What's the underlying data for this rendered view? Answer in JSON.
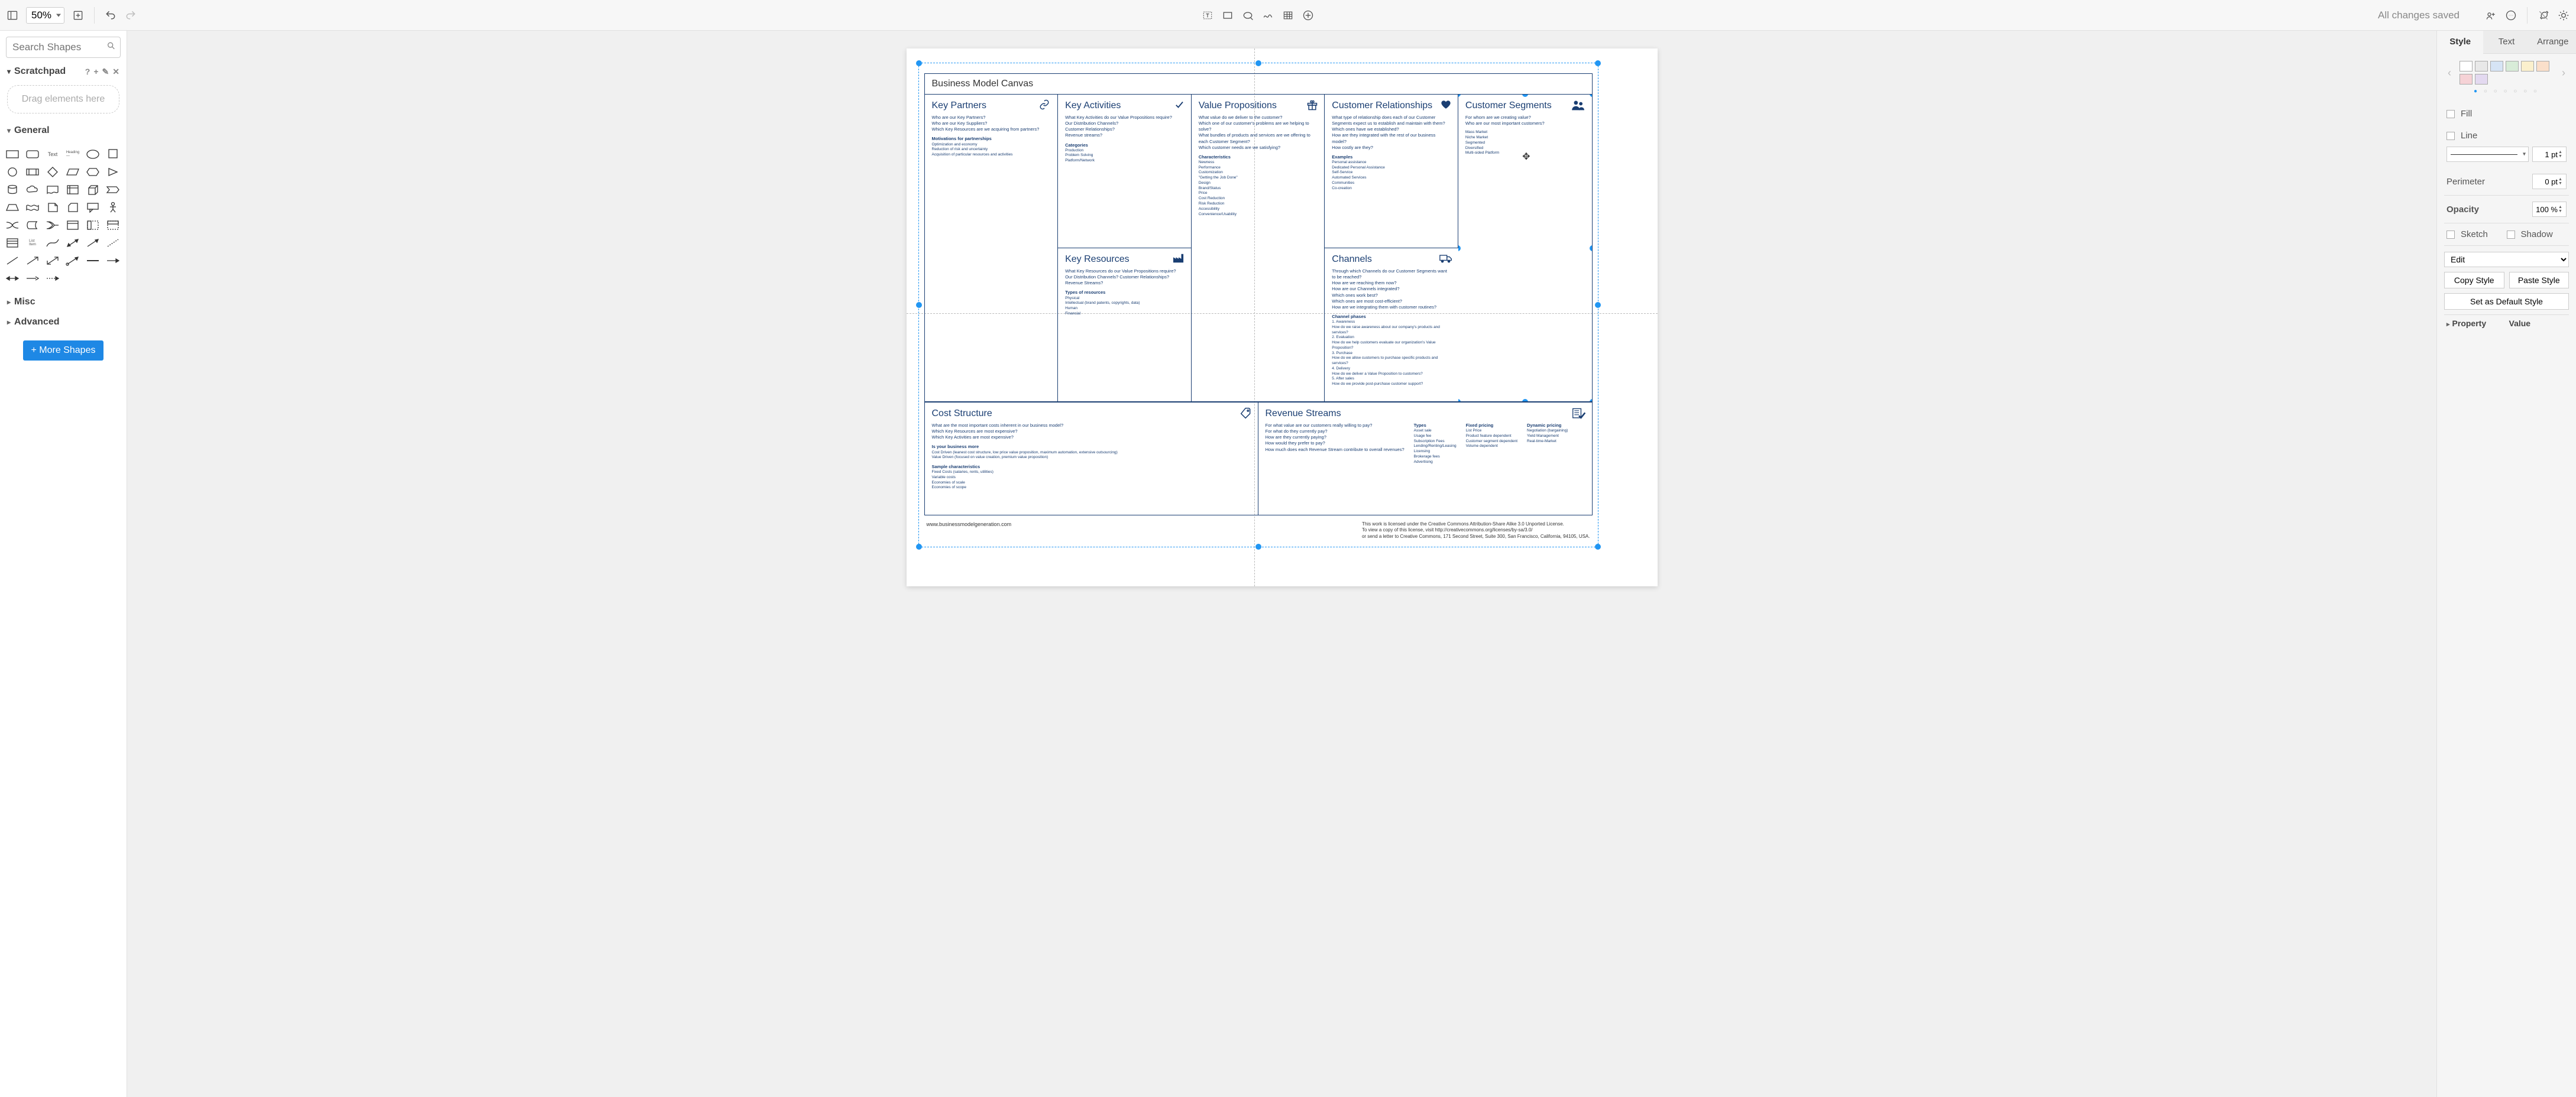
{
  "toolbar": {
    "zoom": "50%",
    "status": "All changes saved"
  },
  "sidebar": {
    "search_placeholder": "Search Shapes",
    "scratchpad_label": "Scratchpad",
    "scratchpad_drop": "Drag elements here",
    "sections": {
      "general": "General",
      "misc": "Misc",
      "advanced": "Advanced"
    },
    "more_shapes": "+ More Shapes"
  },
  "canvas": {
    "title": "Business Model Canvas",
    "footer_url": "www.businessmodelgeneration.com",
    "footer_license": "This work is licensed under the Creative Commons Attribution-Share Alike 3.0 Unported License.\nTo view a copy of this license, visit http://creativecommons.org/licenses/by-sa/3.0/\nor send a letter to Creative Commons, 171 Second Street, Suite 300, San Francisco, California, 94105, USA.",
    "cells": {
      "key_partners": {
        "title": "Key Partners",
        "prompts": "Who are our Key Partners?\nWho are our Key Suppliers?\nWhich Key Resources are we acquiring from partners?",
        "extra_title": "Motivations for partnerships",
        "extra": "Optimization and economy\nReduction of risk and uncertainty\nAcquisition of particular resources and activities"
      },
      "key_activities": {
        "title": "Key Activities",
        "prompts": "What Key Activities do our Value Propositions require?\nOur Distribution Channels?\nCustomer Relationships?\nRevenue streams?",
        "extra_title": "Categories",
        "extra": "Production\nProblem Solving\nPlatform/Network"
      },
      "key_resources": {
        "title": "Key Resources",
        "prompts": "What Key Resources do our Value Propositions require?\nOur Distribution Channels? Customer Relationships?\nRevenue Streams?",
        "extra_title": "Types of resources",
        "extra": "Physical\nIntellectual (brand patents, copyrights, data)\nHuman\nFinancial"
      },
      "value_propositions": {
        "title": "Value Propositions",
        "prompts": "What value do we deliver to the customer?\nWhich one of our customer's problems are we helping to solve?\nWhat bundles of products and services are we offering to each Customer Segment?\nWhich customer needs are we satisfying?",
        "extra_title": "Characteristics",
        "extra": "Newness\nPerformance\nCustomization\n\"Getting the Job Done\"\nDesign\nBrand/Status\nPrice\nCost Reduction\nRisk Reduction\nAccessibility\nConvenience/Usability"
      },
      "customer_relationships": {
        "title": "Customer Relationships",
        "prompts": "What type of relationship does each of our Customer Segments expect us to establish and maintain with them?\nWhich ones have we established?\nHow are they integrated with the rest of our business model?\nHow costly are they?",
        "extra_title": "Examples",
        "extra": "Personal assistance\nDedicated Personal Assistance\nSelf-Service\nAutomated Services\nCommunities\nCo-creation"
      },
      "channels": {
        "title": "Channels",
        "prompts": "Through which Channels do our Customer Segments want to be reached?\nHow are we reaching them now?\nHow are our Channels integrated?\nWhich ones work best?\nWhich ones are most cost-efficient?\nHow are we integrating them with customer routines?",
        "extra_title": "Channel phases",
        "extra": "1. Awareness\n   How do we raise awareness about our company's products and services?\n2. Evaluation\n   How do we help customers evaluate our organization's Value Proposition?\n3. Purchase\n   How do we allow customers to purchase specific products and services?\n4. Delivery\n   How do we deliver a Value Proposition to customers?\n5. After sales\n   How do we provide post-purchase customer support?"
      },
      "customer_segments": {
        "title": "Customer Segments",
        "prompts": "For whom are we creating value?\nWho are our most important customers?",
        "extra": "Mass Market\nNiche Market\nSegmented\nDiversified\nMulti-sided Platform"
      },
      "cost_structure": {
        "title": "Cost Structure",
        "prompts": "What are the most important costs inherent in our business model?\nWhich Key Resources are most expensive?\nWhich Key Activities are most expensive?",
        "sub1_title": "Is your business more",
        "sub1": "Cost Driven (leanest cost structure, low price value proposition, maximum automation, extensive outsourcing)\nValue Driven (focused on value creation, premium value proposition)",
        "sub2_title": "Sample characteristics",
        "sub2": "Fixed Costs (salaries, rents, utilities)\nVariable costs\nEconomies of scale\nEconomies of scope"
      },
      "revenue_streams": {
        "title": "Revenue Streams",
        "prompts": "For what value are our customers really willing to pay?\nFor what do they currently pay?\nHow are they currently paying?\nHow would they prefer to pay?\nHow much does each Revenue Stream contribute to overall revenues?",
        "col_types_title": "Types",
        "col_types": "Asset sale\nUsage fee\nSubscription Fees\nLending/Renting/Leasing\nLicensing\nBrokerage fees\nAdvertising",
        "col_fixed_title": "Fixed pricing",
        "col_fixed": "List Price\nProduct feature dependent\nCustomer segment dependent\nVolume dependent",
        "col_dyn_title": "Dynamic pricing",
        "col_dyn": "Negotiation (bargaining)\nYield Management\nReal-time-Market"
      }
    }
  },
  "right_panel": {
    "tabs": {
      "style": "Style",
      "text": "Text",
      "arrange": "Arrange"
    },
    "fill": "Fill",
    "line": "Line",
    "line_value": "1 pt",
    "perimeter": "Perimeter",
    "perimeter_value": "0 pt",
    "opacity": "Opacity",
    "opacity_value": "100 %",
    "sketch": "Sketch",
    "shadow": "Shadow",
    "edit": "Edit",
    "copy_style": "Copy Style",
    "paste_style": "Paste Style",
    "set_default": "Set as Default Style",
    "property": "Property",
    "value": "Value"
  }
}
